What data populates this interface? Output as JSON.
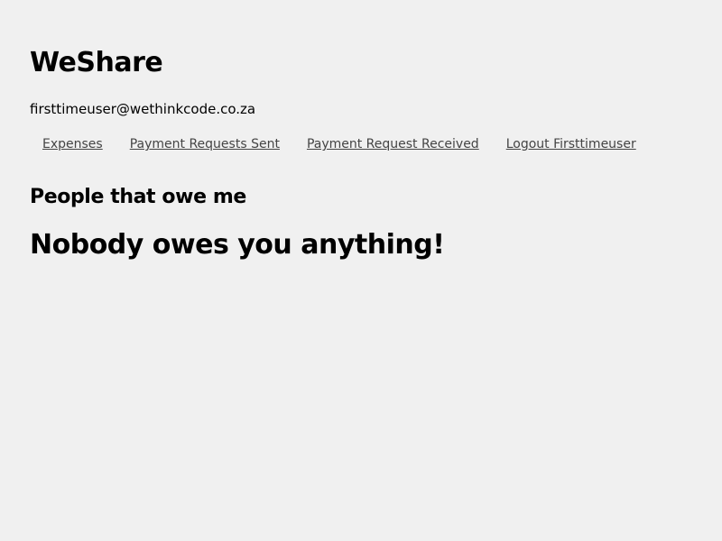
{
  "app": {
    "title": "WeShare"
  },
  "user": {
    "email": "firsttimeuser@wethinkcode.co.za"
  },
  "nav": {
    "expenses": "Expenses",
    "payment_requests_sent": "Payment Requests Sent",
    "payment_request_received": "Payment Request Received",
    "logout": "Logout Firsttimeuser"
  },
  "main": {
    "heading": "People that owe me",
    "empty_message": "Nobody owes you anything!"
  }
}
